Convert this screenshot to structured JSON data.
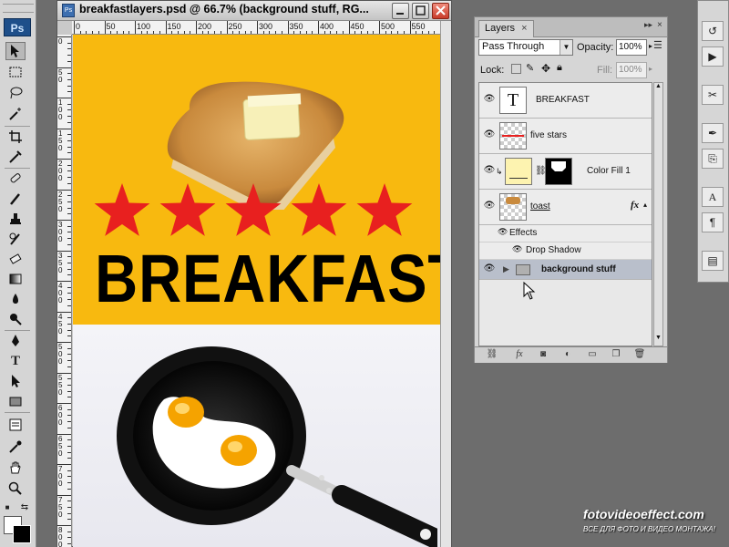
{
  "document": {
    "title": "breakfastlayers.psd @ 66.7% (background stuff, RG...",
    "ruler_top_labels": [
      "0",
      "50",
      "100",
      "150",
      "200",
      "250",
      "300",
      "350",
      "400",
      "450",
      "500",
      "550"
    ],
    "ruler_left_labels": [
      "0",
      "50",
      "100",
      "150",
      "200",
      "250",
      "300",
      "350",
      "400",
      "450",
      "500",
      "550",
      "600",
      "650",
      "700",
      "750",
      "800"
    ],
    "canvas": {
      "headline": "BREAKFAST",
      "star_count": 5,
      "colors": {
        "yellow": "#f8b90f",
        "star": "#e8201f",
        "text": "#000000"
      }
    }
  },
  "tools_panel": {
    "logo": "Ps",
    "tools": [
      "move-icon",
      "marquee-icon",
      "lasso-icon",
      "magic-wand-icon",
      "crop-icon",
      "eyedropper-icon",
      "healing-brush-icon",
      "brush-icon",
      "stamp-icon",
      "history-brush-icon",
      "eraser-icon",
      "gradient-icon",
      "blur-icon",
      "dodge-icon",
      "pen-icon",
      "type-icon",
      "path-select-icon",
      "shape-icon",
      "notes-icon",
      "eyedropper2-icon",
      "hand-icon",
      "zoom-icon"
    ]
  },
  "layers_panel": {
    "tab_label": "Layers",
    "tab_close": "×",
    "blend_mode": "Pass Through",
    "opacity_label": "Opacity:",
    "opacity_value": "100%",
    "lock_label": "Lock:",
    "fill_label": "Fill:",
    "fill_value": "100%",
    "layers": [
      {
        "name": "BREAKFAST",
        "type": "text",
        "thumb_text": "T"
      },
      {
        "name": "five stars",
        "type": "pixel"
      },
      {
        "name": "Color Fill 1",
        "type": "fill",
        "fill_color": "#fdf3b0"
      },
      {
        "name": "toast",
        "type": "pixel",
        "fx": "fx"
      },
      {
        "name": "background stuff",
        "type": "group",
        "selected": true
      }
    ],
    "effects_label": "Effects",
    "drop_shadow_label": "Drop Shadow"
  },
  "watermark": {
    "main": "fotovideoeffect.com",
    "sub": "ВСЕ ДЛЯ ФОТО И ВИДЕО МОНТАЖА!"
  }
}
